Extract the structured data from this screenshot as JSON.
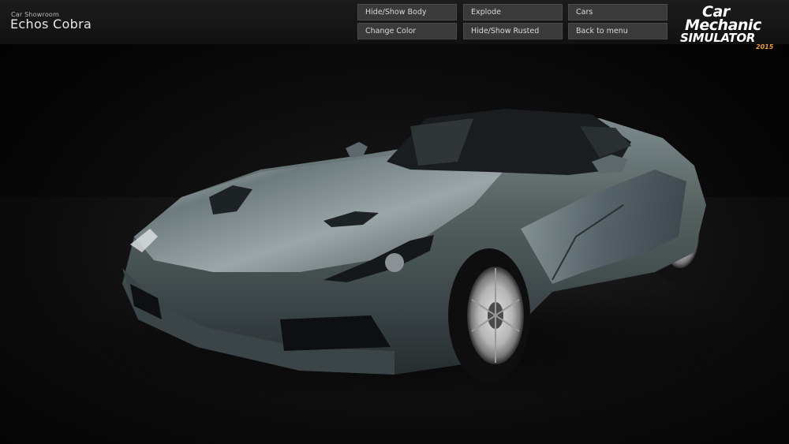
{
  "header": {
    "subtitle": "Car Showroom",
    "title": "Echos Cobra"
  },
  "buttons": {
    "hide_show_body": "Hide/Show Body",
    "explode": "Explode",
    "cars": "Cars",
    "change_color": "Change Color",
    "hide_show_rusted": "Hide/Show Rusted",
    "back_to_menu": "Back to menu"
  },
  "logo": {
    "line1": "Car",
    "line2": "Mechanic",
    "line3": "SIMULATOR",
    "year": "2015"
  },
  "colors": {
    "car_body": "#4a5659",
    "logo_year": "#f0a030",
    "button_bg": "#3a3a3a"
  }
}
